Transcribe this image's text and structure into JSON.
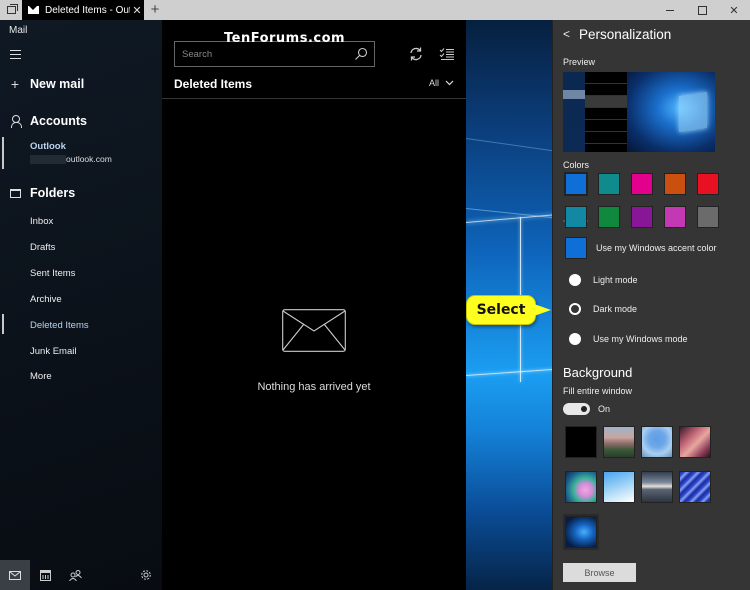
{
  "titlebar": {
    "tab_title": "Deleted Items - Outlook",
    "new_tab_label": "+",
    "close_tab_label": "✕",
    "window_close_label": "✕"
  },
  "nav": {
    "app_name": "Mail",
    "new_mail_label": "New mail",
    "accounts_label": "Accounts",
    "account": {
      "name": "Outlook",
      "email_suffix": "outlook.com"
    },
    "folders_label": "Folders",
    "folders": [
      {
        "label": "Inbox",
        "selected": false
      },
      {
        "label": "Drafts",
        "selected": false
      },
      {
        "label": "Sent Items",
        "selected": false
      },
      {
        "label": "Archive",
        "selected": false
      },
      {
        "label": "Deleted Items",
        "selected": true
      },
      {
        "label": "Junk Email",
        "selected": false
      },
      {
        "label": "More",
        "selected": false
      }
    ],
    "bottom_icons": [
      "mail-icon",
      "calendar-icon",
      "people-icon",
      "gear-icon"
    ]
  },
  "list": {
    "watermark": "TenForums.com",
    "search_placeholder": "Search",
    "folder_title": "Deleted Items",
    "filter_label": "All",
    "empty_message": "Nothing has arrived yet"
  },
  "callout": {
    "text": "Select",
    "color": "#ffff1f"
  },
  "personalization": {
    "back_label": "<",
    "title": "Personalization",
    "preview_label": "Preview",
    "colors_label": "Colors",
    "colors_row1": [
      "#0f6fd6",
      "#0f8b8d",
      "#e3008c",
      "#ca5010",
      "#e81123"
    ],
    "colors_row2": [
      "#1388a5",
      "#10893e",
      "#881798",
      "#c239b3",
      "#6b6b6b"
    ],
    "selected_color": "#0f6fd6",
    "accent_color": "#0f6fd6",
    "use_accent_label": "Use my Windows accent color",
    "modes": [
      {
        "label": "Light mode",
        "selected": false
      },
      {
        "label": "Dark mode",
        "selected": true
      },
      {
        "label": "Use my Windows mode",
        "selected": false
      }
    ],
    "background_title": "Background",
    "fill_label": "Fill entire window",
    "toggle_state": "On",
    "backgrounds": [
      "black",
      "mountain",
      "tree",
      "canyon",
      "abstract-waves",
      "blue-prisms",
      "lake-sunset",
      "blue-streaks",
      "windows-logo"
    ],
    "selected_background": "windows-logo",
    "browse_label": "Browse"
  }
}
